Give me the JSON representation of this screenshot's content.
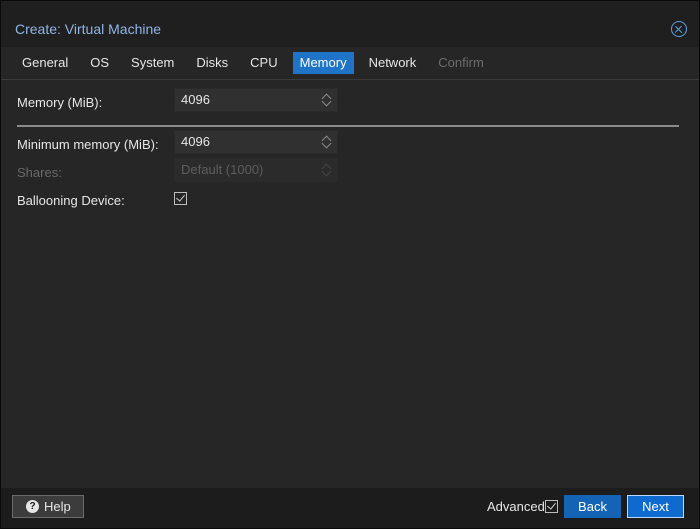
{
  "window": {
    "title": "Create: Virtual Machine"
  },
  "tabs": [
    {
      "label": "General",
      "state": "normal"
    },
    {
      "label": "OS",
      "state": "normal"
    },
    {
      "label": "System",
      "state": "normal"
    },
    {
      "label": "Disks",
      "state": "normal"
    },
    {
      "label": "CPU",
      "state": "normal"
    },
    {
      "label": "Memory",
      "state": "active"
    },
    {
      "label": "Network",
      "state": "normal"
    },
    {
      "label": "Confirm",
      "state": "disabled"
    }
  ],
  "form": {
    "memory": {
      "label": "Memory (MiB):",
      "value": "4096"
    },
    "min_memory": {
      "label": "Minimum memory (MiB):",
      "value": "4096"
    },
    "shares": {
      "label": "Shares:",
      "placeholder": "Default (1000)",
      "disabled": true
    },
    "ballooning": {
      "label": "Ballooning Device:",
      "checked": true
    }
  },
  "footer": {
    "help_label": "Help",
    "advanced_label": "Advanced",
    "advanced_checked": true,
    "back_label": "Back",
    "next_label": "Next"
  },
  "colors": {
    "accent": "#1f74c8",
    "title": "#8fb5e8",
    "background": "#262626"
  }
}
